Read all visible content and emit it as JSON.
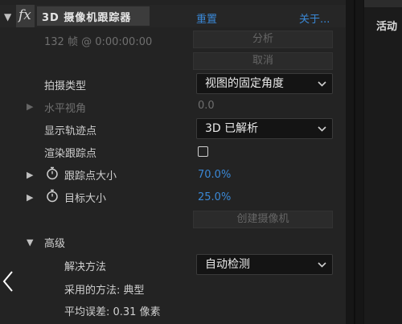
{
  "header": {
    "collapse_arrow": "▼",
    "fx_label": "fx",
    "effect_title": "3D 摄像机跟踪器",
    "reset_label": "重置",
    "about_label": "关于..."
  },
  "status": {
    "frame_info": "132 帧 @ 0:00:00:00"
  },
  "buttons": {
    "analyze": "分析",
    "cancel": "取消",
    "create_camera": "创建摄像机"
  },
  "properties": {
    "shot_type": {
      "label": "拍摄类型",
      "value": "视图的固定角度"
    },
    "horizontal_fov": {
      "label": "水平视角",
      "value": "0.0"
    },
    "show_track_points": {
      "label": "显示轨迹点",
      "value": "3D 已解析"
    },
    "render_track_points": {
      "label": "渲染跟踪点",
      "checked": false
    },
    "track_point_size": {
      "label": "跟踪点大小",
      "value": "70.0%"
    },
    "target_size": {
      "label": "目标大小",
      "value": "25.0%"
    }
  },
  "advanced": {
    "label": "高级",
    "solve_method": {
      "label": "解决方法",
      "value": "自动检测"
    },
    "method_used": "采用的方法: 典型",
    "average_error": "平均误差: 0.31 像素"
  },
  "right_panel": {
    "title": "活动"
  },
  "icons": {
    "expand": "▶",
    "collapse": "▼",
    "stopwatch": "stopwatch-icon",
    "chevron": "chevron-down-icon",
    "back": "chevron-left-icon"
  },
  "colors": {
    "link_blue": "#3a88d6",
    "panel_bg": "#232323"
  }
}
